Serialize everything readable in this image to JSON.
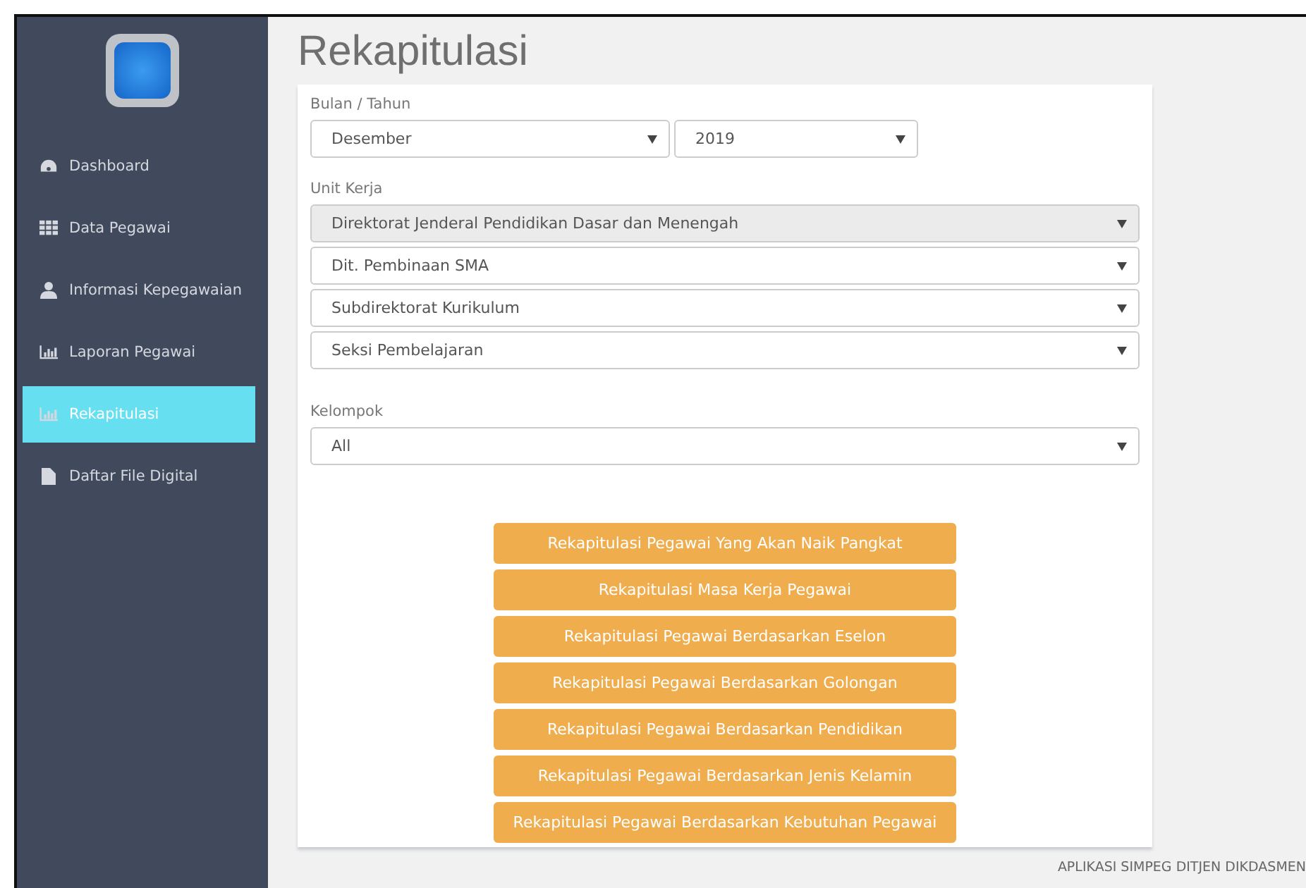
{
  "sidebar": {
    "items": [
      {
        "label": "Dashboard",
        "selected": false
      },
      {
        "label": "Data Pegawai",
        "selected": false
      },
      {
        "label": "Informasi Kepegawaian",
        "selected": false
      },
      {
        "label": "Laporan Pegawai",
        "selected": false
      },
      {
        "label": "Rekapitulasi",
        "selected": true
      },
      {
        "label": "Daftar File Digital",
        "selected": false
      }
    ]
  },
  "page_title": "Rekapitulasi",
  "form": {
    "period": {
      "label": "Bulan / Tahun",
      "month": {
        "value": "Desember",
        "disabled": false
      },
      "year": {
        "value": "2019",
        "disabled": false
      }
    },
    "unit": {
      "label": "Unit Kerja",
      "selects": [
        {
          "value": "Direktorat Jenderal Pendidikan Dasar dan Menengah",
          "disabled": true
        },
        {
          "value": "Dit. Pembinaan SMA",
          "disabled": false
        },
        {
          "value": "Subdirektorat Kurikulum",
          "disabled": false
        },
        {
          "value": "Seksi Pembelajaran",
          "disabled": false
        }
      ]
    },
    "group": {
      "label": "Kelompok",
      "select": {
        "value": "All",
        "disabled": false
      }
    },
    "buttons": [
      "Rekapitulasi Pegawai Yang Akan Naik Pangkat",
      "Rekapitulasi Masa Kerja Pegawai",
      "Rekapitulasi Pegawai Berdasarkan Eselon",
      "Rekapitulasi Pegawai Berdasarkan Golongan",
      "Rekapitulasi Pegawai Berdasarkan Pendidikan",
      "Rekapitulasi Pegawai Berdasarkan Jenis Kelamin",
      "Rekapitulasi Pegawai Berdasarkan Kebutuhan Pegawai"
    ]
  },
  "footer": "APLIKASI SIMPEG DITJEN DIKDASMEN"
}
